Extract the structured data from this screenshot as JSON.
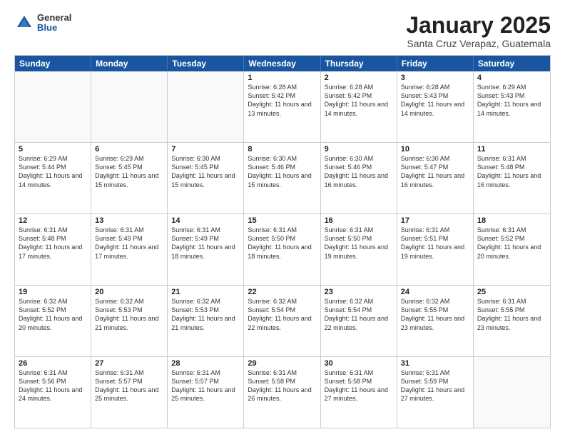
{
  "logo": {
    "general": "General",
    "blue": "Blue"
  },
  "title": {
    "month": "January 2025",
    "location": "Santa Cruz Verapaz, Guatemala"
  },
  "dayHeaders": [
    "Sunday",
    "Monday",
    "Tuesday",
    "Wednesday",
    "Thursday",
    "Friday",
    "Saturday"
  ],
  "weeks": [
    [
      {
        "day": "",
        "empty": true
      },
      {
        "day": "",
        "empty": true
      },
      {
        "day": "",
        "empty": true
      },
      {
        "day": "1",
        "info": "Sunrise: 6:28 AM\nSunset: 5:42 PM\nDaylight: 11 hours\nand 13 minutes."
      },
      {
        "day": "2",
        "info": "Sunrise: 6:28 AM\nSunset: 5:42 PM\nDaylight: 11 hours\nand 14 minutes."
      },
      {
        "day": "3",
        "info": "Sunrise: 6:28 AM\nSunset: 5:43 PM\nDaylight: 11 hours\nand 14 minutes."
      },
      {
        "day": "4",
        "info": "Sunrise: 6:29 AM\nSunset: 5:43 PM\nDaylight: 11 hours\nand 14 minutes."
      }
    ],
    [
      {
        "day": "5",
        "info": "Sunrise: 6:29 AM\nSunset: 5:44 PM\nDaylight: 11 hours\nand 14 minutes."
      },
      {
        "day": "6",
        "info": "Sunrise: 6:29 AM\nSunset: 5:45 PM\nDaylight: 11 hours\nand 15 minutes."
      },
      {
        "day": "7",
        "info": "Sunrise: 6:30 AM\nSunset: 5:45 PM\nDaylight: 11 hours\nand 15 minutes."
      },
      {
        "day": "8",
        "info": "Sunrise: 6:30 AM\nSunset: 5:46 PM\nDaylight: 11 hours\nand 15 minutes."
      },
      {
        "day": "9",
        "info": "Sunrise: 6:30 AM\nSunset: 5:46 PM\nDaylight: 11 hours\nand 16 minutes."
      },
      {
        "day": "10",
        "info": "Sunrise: 6:30 AM\nSunset: 5:47 PM\nDaylight: 11 hours\nand 16 minutes."
      },
      {
        "day": "11",
        "info": "Sunrise: 6:31 AM\nSunset: 5:48 PM\nDaylight: 11 hours\nand 16 minutes."
      }
    ],
    [
      {
        "day": "12",
        "info": "Sunrise: 6:31 AM\nSunset: 5:48 PM\nDaylight: 11 hours\nand 17 minutes."
      },
      {
        "day": "13",
        "info": "Sunrise: 6:31 AM\nSunset: 5:49 PM\nDaylight: 11 hours\nand 17 minutes."
      },
      {
        "day": "14",
        "info": "Sunrise: 6:31 AM\nSunset: 5:49 PM\nDaylight: 11 hours\nand 18 minutes."
      },
      {
        "day": "15",
        "info": "Sunrise: 6:31 AM\nSunset: 5:50 PM\nDaylight: 11 hours\nand 18 minutes."
      },
      {
        "day": "16",
        "info": "Sunrise: 6:31 AM\nSunset: 5:50 PM\nDaylight: 11 hours\nand 19 minutes."
      },
      {
        "day": "17",
        "info": "Sunrise: 6:31 AM\nSunset: 5:51 PM\nDaylight: 11 hours\nand 19 minutes."
      },
      {
        "day": "18",
        "info": "Sunrise: 6:31 AM\nSunset: 5:52 PM\nDaylight: 11 hours\nand 20 minutes."
      }
    ],
    [
      {
        "day": "19",
        "info": "Sunrise: 6:32 AM\nSunset: 5:52 PM\nDaylight: 11 hours\nand 20 minutes."
      },
      {
        "day": "20",
        "info": "Sunrise: 6:32 AM\nSunset: 5:53 PM\nDaylight: 11 hours\nand 21 minutes."
      },
      {
        "day": "21",
        "info": "Sunrise: 6:32 AM\nSunset: 5:53 PM\nDaylight: 11 hours\nand 21 minutes."
      },
      {
        "day": "22",
        "info": "Sunrise: 6:32 AM\nSunset: 5:54 PM\nDaylight: 11 hours\nand 22 minutes."
      },
      {
        "day": "23",
        "info": "Sunrise: 6:32 AM\nSunset: 5:54 PM\nDaylight: 11 hours\nand 22 minutes."
      },
      {
        "day": "24",
        "info": "Sunrise: 6:32 AM\nSunset: 5:55 PM\nDaylight: 11 hours\nand 23 minutes."
      },
      {
        "day": "25",
        "info": "Sunrise: 6:31 AM\nSunset: 5:55 PM\nDaylight: 11 hours\nand 23 minutes."
      }
    ],
    [
      {
        "day": "26",
        "info": "Sunrise: 6:31 AM\nSunset: 5:56 PM\nDaylight: 11 hours\nand 24 minutes."
      },
      {
        "day": "27",
        "info": "Sunrise: 6:31 AM\nSunset: 5:57 PM\nDaylight: 11 hours\nand 25 minutes."
      },
      {
        "day": "28",
        "info": "Sunrise: 6:31 AM\nSunset: 5:57 PM\nDaylight: 11 hours\nand 25 minutes."
      },
      {
        "day": "29",
        "info": "Sunrise: 6:31 AM\nSunset: 5:58 PM\nDaylight: 11 hours\nand 26 minutes."
      },
      {
        "day": "30",
        "info": "Sunrise: 6:31 AM\nSunset: 5:58 PM\nDaylight: 11 hours\nand 27 minutes."
      },
      {
        "day": "31",
        "info": "Sunrise: 6:31 AM\nSunset: 5:59 PM\nDaylight: 11 hours\nand 27 minutes."
      },
      {
        "day": "",
        "empty": true
      }
    ]
  ]
}
